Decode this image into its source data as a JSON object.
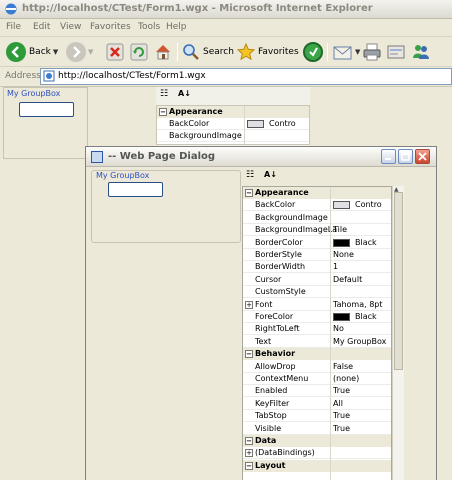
{
  "browser": {
    "title": "http://localhost/CTest/Form1.wgx - Microsoft Internet Explorer",
    "menu": [
      "File",
      "Edit",
      "View",
      "Favorites",
      "Tools",
      "Help"
    ],
    "toolbar": {
      "back": "Back",
      "search": "Search",
      "favorites": "Favorites"
    },
    "address_label": "Address",
    "url": "http://localhost/CTest/Form1.wgx"
  },
  "page": {
    "groupbox_caption": "My GroupBox",
    "grid": {
      "category": "Appearance",
      "rows": [
        {
          "name": "BackColor",
          "value": "Contro"
        },
        {
          "name": "BackgroundImage",
          "value": ""
        }
      ]
    }
  },
  "dialog": {
    "title": "-- Web Page Dialog",
    "groupbox_caption": "My GroupBox",
    "grid": [
      {
        "type": "cat",
        "name": "Appearance"
      },
      {
        "type": "prop",
        "name": "BackColor",
        "value": "Contro",
        "swatch": "#e0dfe3"
      },
      {
        "type": "prop",
        "name": "BackgroundImage",
        "value": ""
      },
      {
        "type": "prop",
        "name": "BackgroundImageLa",
        "value": "Tile"
      },
      {
        "type": "prop",
        "name": "BorderColor",
        "value": "Black",
        "swatch": "#000000"
      },
      {
        "type": "prop",
        "name": "BorderStyle",
        "value": "None"
      },
      {
        "type": "prop",
        "name": "BorderWidth",
        "value": "1"
      },
      {
        "type": "prop",
        "name": "Cursor",
        "value": "Default"
      },
      {
        "type": "prop",
        "name": "CustomStyle",
        "value": ""
      },
      {
        "type": "exp",
        "name": "Font",
        "value": "Tahoma, 8pt"
      },
      {
        "type": "prop",
        "name": "ForeColor",
        "value": "Black",
        "swatch": "#000000"
      },
      {
        "type": "prop",
        "name": "RightToLeft",
        "value": "No"
      },
      {
        "type": "prop",
        "name": "Text",
        "value": "My GroupBox"
      },
      {
        "type": "cat",
        "name": "Behavior"
      },
      {
        "type": "prop",
        "name": "AllowDrop",
        "value": "False"
      },
      {
        "type": "prop",
        "name": "ContextMenu",
        "value": "(none)"
      },
      {
        "type": "prop",
        "name": "Enabled",
        "value": "True"
      },
      {
        "type": "prop",
        "name": "KeyFilter",
        "value": "All"
      },
      {
        "type": "prop",
        "name": "TabStop",
        "value": "True"
      },
      {
        "type": "prop",
        "name": "Visible",
        "value": "True"
      },
      {
        "type": "cat",
        "name": "Data"
      },
      {
        "type": "exp",
        "name": "(DataBindings)",
        "value": ""
      },
      {
        "type": "cat",
        "name": "Layout"
      }
    ]
  }
}
